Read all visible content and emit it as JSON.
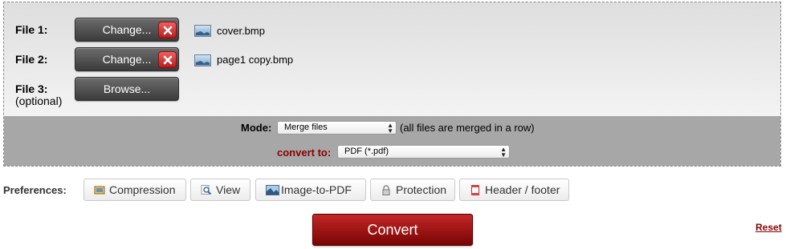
{
  "files": [
    {
      "label": "File 1:",
      "button": "Change...",
      "filename": "cover.bmp"
    },
    {
      "label": "File 2:",
      "button": "Change...",
      "filename": "page1 copy.bmp"
    },
    {
      "label": "File 3:",
      "optional": "(optional)",
      "button": "Browse..."
    }
  ],
  "mode": {
    "label": "Mode:",
    "selected": "Merge files",
    "note": "(all files are merged in a row)"
  },
  "convert_to": {
    "label": "convert to:",
    "selected": "PDF (*.pdf)",
    "label_color": "#8b0000"
  },
  "preferences": {
    "label": "Preferences:",
    "buttons": [
      {
        "label": "Compression",
        "icon": "compression-icon"
      },
      {
        "label": "View",
        "icon": "magnifier-icon"
      },
      {
        "label": "Image-to-PDF",
        "icon": "image-icon"
      },
      {
        "label": "Protection",
        "icon": "lock-icon"
      },
      {
        "label": "Header / footer",
        "icon": "document-icon"
      }
    ]
  },
  "actions": {
    "convert": "Convert",
    "reset": "Reset"
  },
  "colors": {
    "convert_button": "#a01010",
    "delete_button": "#d03030",
    "mode_band": "#a7a7a7"
  }
}
